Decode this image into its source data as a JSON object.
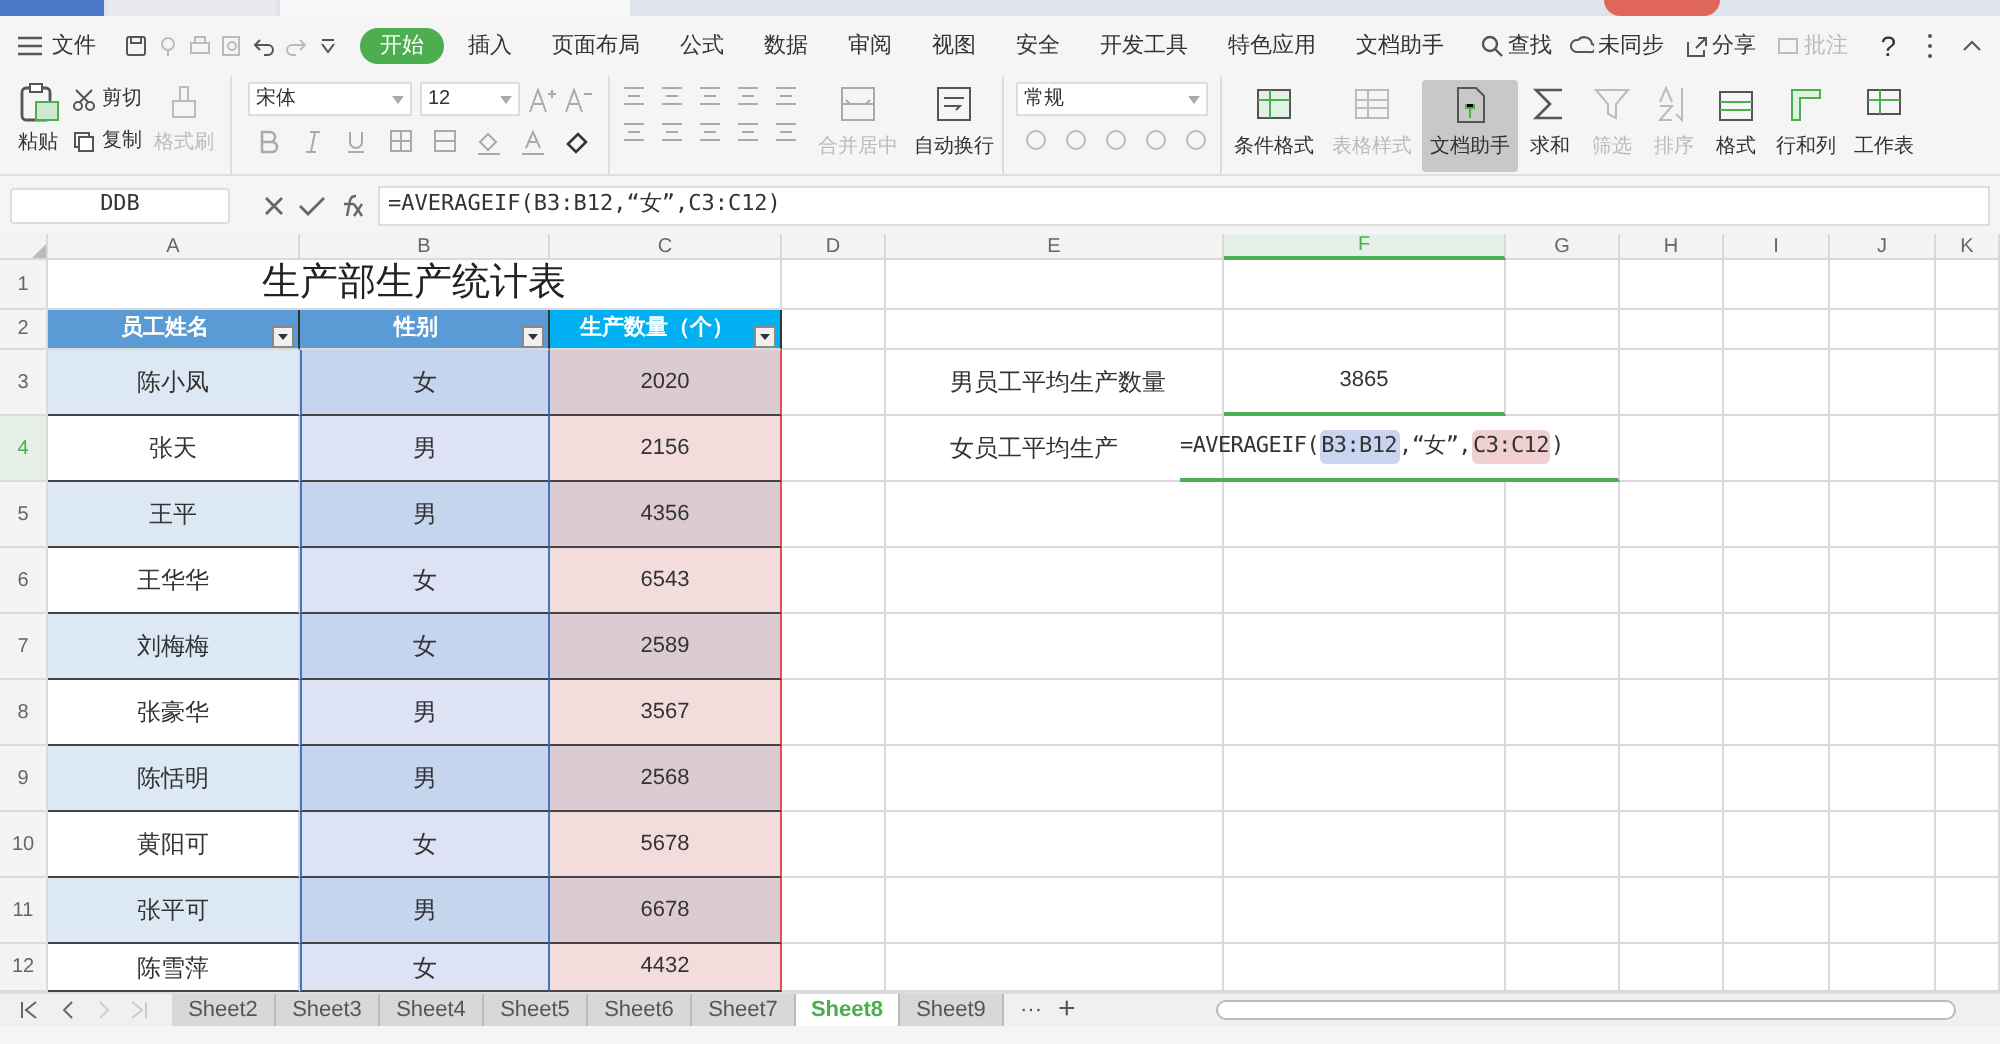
{
  "menu": {
    "file": "文件",
    "tabs": [
      {
        "label": "开始",
        "selected": true
      },
      {
        "label": "插入",
        "selected": false
      },
      {
        "label": "页面布局",
        "selected": false
      },
      {
        "label": "公式",
        "selected": false
      },
      {
        "label": "数据",
        "selected": false
      },
      {
        "label": "审阅",
        "selected": false
      },
      {
        "label": "视图",
        "selected": false
      },
      {
        "label": "安全",
        "selected": false
      },
      {
        "label": "开发工具",
        "selected": false
      },
      {
        "label": "特色应用",
        "selected": false
      },
      {
        "label": "文档助手",
        "selected": false
      }
    ],
    "search": "查找",
    "actions": [
      {
        "kind": "sync",
        "label": "未同步",
        "disabled": false
      },
      {
        "kind": "share",
        "label": "分享",
        "disabled": false
      },
      {
        "kind": "comment",
        "label": "批注",
        "disabled": true
      }
    ],
    "help": "?"
  },
  "ribbon": {
    "clipboard": [
      {
        "kind": "paste",
        "label": "粘贴",
        "disabled": false
      },
      {
        "kind": "cut",
        "label": "剪切",
        "disabled": false
      },
      {
        "kind": "copy",
        "label": "复制",
        "disabled": false
      },
      {
        "kind": "painter",
        "label": "格式刷",
        "disabled": true
      }
    ],
    "font": "宋体",
    "size": "12",
    "number_format": "常规",
    "large": [
      {
        "kind": "merge",
        "label": "合并居中",
        "disabled": true,
        "selected": false
      },
      {
        "kind": "wrap",
        "label": "自动换行",
        "disabled": false,
        "selected": false
      }
    ],
    "large2": [
      {
        "kind": "cond",
        "label": "条件格式",
        "disabled": false,
        "selected": false
      },
      {
        "kind": "tablestyle",
        "label": "表格样式",
        "disabled": true,
        "selected": false
      },
      {
        "kind": "helper",
        "label": "文档助手",
        "disabled": false,
        "selected": true
      },
      {
        "kind": "sum",
        "label": "求和",
        "disabled": false,
        "selected": false
      },
      {
        "kind": "filter",
        "label": "筛选",
        "disabled": true,
        "selected": false
      },
      {
        "kind": "sort",
        "label": "排序",
        "disabled": true,
        "selected": false
      },
      {
        "kind": "format",
        "label": "格式",
        "disabled": false,
        "selected": false
      },
      {
        "kind": "rowcol",
        "label": "行和列",
        "disabled": false,
        "selected": false
      },
      {
        "kind": "sheet",
        "label": "工作表",
        "disabled": false,
        "selected": false
      }
    ]
  },
  "formula_bar": {
    "name_box": "DDB",
    "formula": "=AVERAGEIF(B3:B12,“女”,C3:C12)"
  },
  "columns": [
    {
      "label": "A",
      "selected": false
    },
    {
      "label": "B",
      "selected": false
    },
    {
      "label": "C",
      "selected": false
    },
    {
      "label": "D",
      "selected": false
    },
    {
      "label": "E",
      "selected": false
    },
    {
      "label": "F",
      "selected": true
    },
    {
      "label": "G",
      "selected": false
    },
    {
      "label": "H",
      "selected": false
    },
    {
      "label": "I",
      "selected": false
    },
    {
      "label": "J",
      "selected": false
    },
    {
      "label": "K",
      "selected": false
    }
  ],
  "row_numbers": [
    {
      "label": "1",
      "selected": false
    },
    {
      "label": "2",
      "selected": false
    },
    {
      "label": "3",
      "selected": false
    },
    {
      "label": "4",
      "selected": true
    },
    {
      "label": "5",
      "selected": false
    },
    {
      "label": "6",
      "selected": false
    },
    {
      "label": "7",
      "selected": false
    },
    {
      "label": "8",
      "selected": false
    },
    {
      "label": "9",
      "selected": false
    },
    {
      "label": "10",
      "selected": false
    },
    {
      "label": "11",
      "selected": false
    },
    {
      "label": "12",
      "selected": false
    }
  ],
  "table": {
    "title": "生产部生产统计表",
    "headers": [
      "员工姓名",
      "性别",
      "生产数量（个）"
    ],
    "rows": [
      {
        "name": "陈小凤",
        "gender": "女",
        "count": "2020",
        "banded": true
      },
      {
        "name": "张天",
        "gender": "男",
        "count": "2156",
        "banded": false
      },
      {
        "name": "王平",
        "gender": "男",
        "count": "4356",
        "banded": true
      },
      {
        "name": "王华华",
        "gender": "女",
        "count": "6543",
        "banded": false
      },
      {
        "name": "刘梅梅",
        "gender": "女",
        "count": "2589",
        "banded": true
      },
      {
        "name": "张豪华",
        "gender": "男",
        "count": "3567",
        "banded": false
      },
      {
        "name": "陈恬明",
        "gender": "男",
        "count": "2568",
        "banded": true
      },
      {
        "name": "黄阳可",
        "gender": "女",
        "count": "5678",
        "banded": false
      },
      {
        "name": "张平可",
        "gender": "男",
        "count": "6678",
        "banded": true
      },
      {
        "name": "陈雪萍",
        "gender": "女",
        "count": "4432",
        "banded": false
      }
    ]
  },
  "summary": {
    "male_label": "男员工平均生产数量",
    "male_value": "3865",
    "female_label": "女员工平均生产",
    "female_formula": [
      {
        "text": "=AVERAGEIF("
      },
      {
        "text": "B3:B12",
        "color": "#c9d5f0"
      },
      {
        "text": ",“女”,"
      },
      {
        "text": "C3:C12",
        "color": "#f0d0d0"
      },
      {
        "text": ")"
      }
    ]
  },
  "sheet_tabs": [
    {
      "label": "Sheet2",
      "selected": false
    },
    {
      "label": "Sheet3",
      "selected": false
    },
    {
      "label": "Sheet4",
      "selected": false
    },
    {
      "label": "Sheet5",
      "selected": false
    },
    {
      "label": "Sheet6",
      "selected": false
    },
    {
      "label": "Sheet7",
      "selected": false
    },
    {
      "label": "Sheet8",
      "selected": true
    },
    {
      "label": "Sheet9",
      "selected": false
    }
  ],
  "more_tabs": "···",
  "add_tab": "+"
}
